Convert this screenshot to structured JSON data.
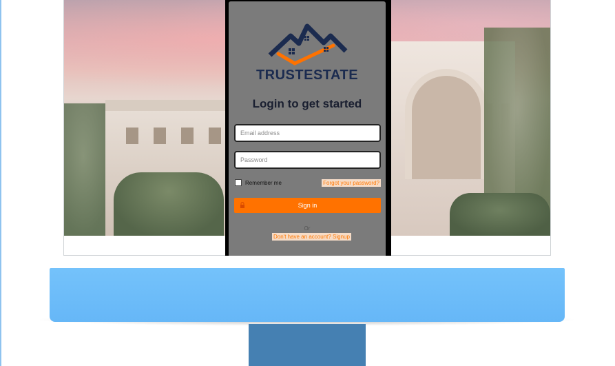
{
  "brand": {
    "name": "TRUSTESTATE",
    "logo_icon": "house-roofs-logo-icon",
    "colors": {
      "navy": "#1b2b4f",
      "orange": "#ff7200"
    }
  },
  "login": {
    "heading": "Login to get started",
    "email": {
      "placeholder": "Email address",
      "value": ""
    },
    "password": {
      "placeholder": "Password",
      "value": ""
    },
    "remember_label": "Remember me",
    "remember_checked": false,
    "forgot_link": "Forgot your password?",
    "signin_label": "Sign in",
    "signin_icon": "lock-icon",
    "or_text": "Or",
    "signup_link": "Don't have an account? Signup"
  },
  "monitor": {
    "screen_background": "luxury-mansion-photo",
    "base_color": "#6ebcf9",
    "stand_color": "#4580b2"
  }
}
